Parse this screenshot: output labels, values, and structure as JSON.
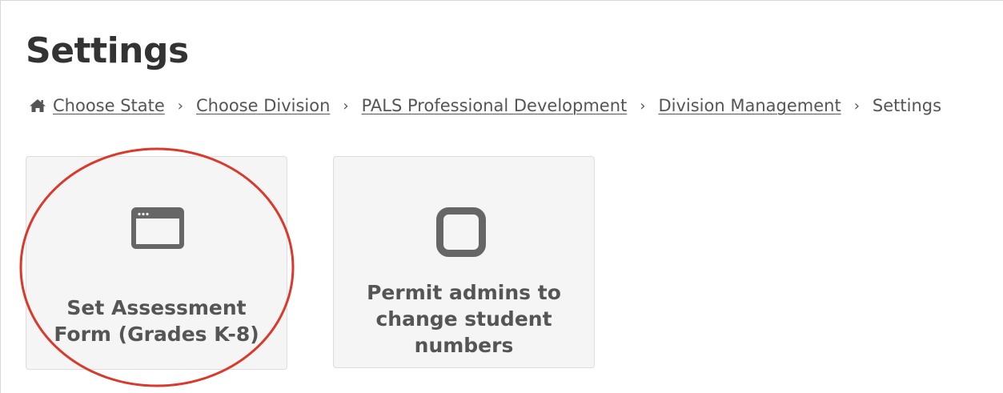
{
  "page": {
    "title": "Settings"
  },
  "breadcrumb": {
    "home_icon": "home-icon",
    "items": [
      {
        "label": "Choose State"
      },
      {
        "label": "Choose Division"
      },
      {
        "label": "PALS Professional Development"
      },
      {
        "label": "Division Management"
      }
    ],
    "current": "Settings",
    "separator": "›"
  },
  "cards": [
    {
      "label_line1": "Set Assessment",
      "label_line2": "Form (Grades K-8)",
      "icon": "window-icon"
    },
    {
      "label_line1": "Permit admins to",
      "label_line2": "change student",
      "label_line3": "numbers",
      "icon": "square-icon"
    }
  ],
  "colors": {
    "text": "#555555",
    "title": "#333333",
    "card_bg": "#f5f5f5",
    "card_border": "#dddddd",
    "icon": "#666666",
    "highlight": "#d93a2b"
  }
}
